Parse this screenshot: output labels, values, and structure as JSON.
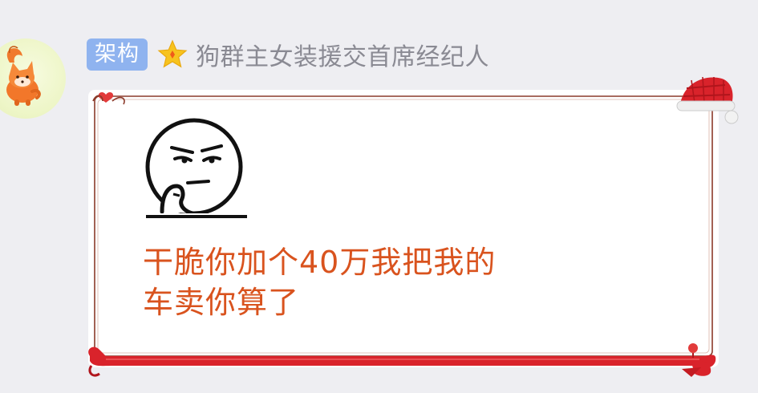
{
  "chat": {
    "sender": {
      "role_badge": "架构",
      "badge_color": "#8fb3ef",
      "nickname": "狗群主女装援交首席经纪人",
      "level_icon": "star-icon",
      "avatar_icon": "fox-avatar-icon"
    },
    "message": {
      "sticker": "thinking-face-sticker-icon",
      "text_lines": [
        "  干脆你加个40万我把我的",
        "车卖你算了"
      ],
      "text_color": "#d9531e",
      "bubble_theme": "christmas-red-frame"
    }
  }
}
